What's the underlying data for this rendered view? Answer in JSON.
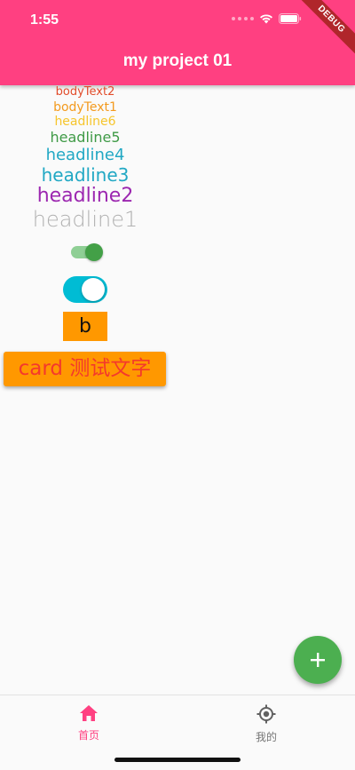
{
  "status_bar": {
    "time": "1:55"
  },
  "app_bar": {
    "title": "my project 01",
    "color": "#ff4081"
  },
  "debug_banner": "DEBUG",
  "text_styles": {
    "bodyText2": "bodyText2",
    "bodyText1": "bodyText1",
    "headline6": "headline6",
    "headline5": "headline5",
    "headline4": "headline4",
    "headline3": "headline3",
    "headline2": "headline2",
    "headline1": "headline1"
  },
  "switches": {
    "material_switch": {
      "on": true,
      "color": "#43a047"
    },
    "cupertino_switch": {
      "on": true,
      "color": "#00bcd4"
    }
  },
  "box_b": {
    "label": "b",
    "color": "#ff9800"
  },
  "card": {
    "text": "card 测试文字",
    "color": "#ff9800",
    "text_color": "#f4392c"
  },
  "fab": {
    "icon": "add-icon",
    "color": "#4caf50"
  },
  "bottom_nav": {
    "items": [
      {
        "label": "首页",
        "icon": "home-icon",
        "active": true
      },
      {
        "label": "我的",
        "icon": "my-location-icon",
        "active": false
      }
    ],
    "active_color": "#ff4081"
  }
}
